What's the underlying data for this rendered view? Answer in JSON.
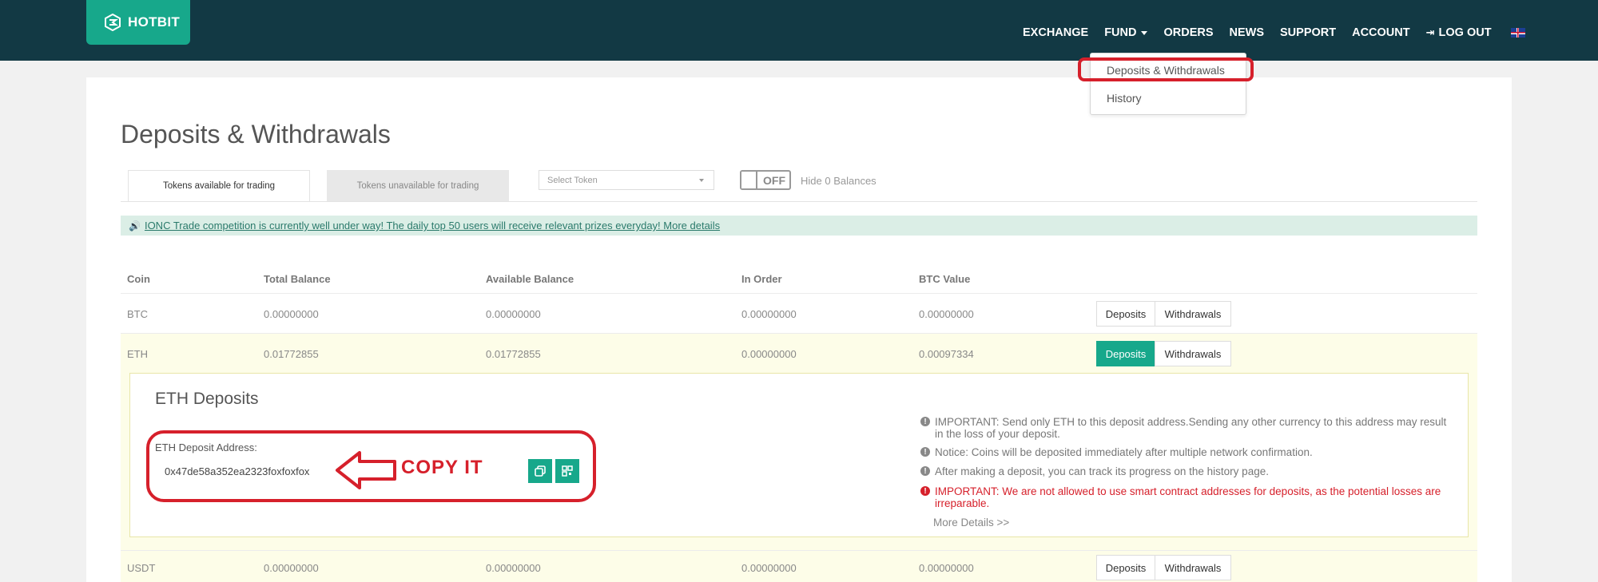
{
  "brand": {
    "name": "HOTBIT"
  },
  "nav": {
    "exchange": "EXCHANGE",
    "fund": "FUND",
    "orders": "ORDERS",
    "news": "NEWS",
    "support": "SUPPORT",
    "account": "ACCOUNT",
    "logout": "LOG OUT"
  },
  "dropdown": {
    "item1": "Deposits & Withdrawals",
    "item2": "History"
  },
  "page": {
    "title": "Deposits & Withdrawals"
  },
  "tabs": {
    "available": "Tokens available for trading",
    "unavailable": "Tokens unavailable for trading"
  },
  "filters": {
    "select_token": "Select Token",
    "toggle": "OFF",
    "hide_zero": "Hide 0 Balances"
  },
  "notice": {
    "text": "IONC Trade competition is currently well under way! The daily top 50 users will receive relevant prizes everyday! More details"
  },
  "table": {
    "headers": {
      "coin": "Coin",
      "total": "Total Balance",
      "available": "Available Balance",
      "in_order": "In Order",
      "btc_value": "BTC Value"
    },
    "rows": [
      {
        "coin": "BTC",
        "total": "0.00000000",
        "available": "0.00000000",
        "in_order": "0.00000000",
        "btc_value": "0.00000000"
      },
      {
        "coin": "ETH",
        "total": "0.01772855",
        "available": "0.01772855",
        "in_order": "0.00000000",
        "btc_value": "0.00097334"
      },
      {
        "coin": "USDT",
        "total": "0.00000000",
        "available": "0.00000000",
        "in_order": "0.00000000",
        "btc_value": "0.00000000"
      }
    ],
    "deposits_label": "Deposits",
    "withdrawals_label": "Withdrawals"
  },
  "deposit": {
    "title": "ETH Deposits",
    "address_label": "ETH Deposit Address:",
    "address": "0x47de58a352ea2323foxfoxfox",
    "annotation": "COPY IT",
    "info": [
      "IMPORTANT: Send only ETH to this deposit address.Sending any other currency to this address may result in the loss of your deposit.",
      "Notice: Coins will be deposited immediately after multiple network confirmation.",
      "After making a deposit, you can track its progress on the history page.",
      "IMPORTANT: We are not allowed to use smart contract addresses for deposits, as the potential losses are irreparable."
    ],
    "more_details": "More Details >>"
  },
  "colors": {
    "topbar": "#123944",
    "accent": "#17a88b",
    "alert_red": "#d6202b",
    "notice_bg": "#dbeee6",
    "row_highlight": "#fdfde8"
  },
  "icons": {
    "logo": "hotbit-logo-icon",
    "copy": "copy-icon",
    "qr": "qr-code-icon",
    "info": "info-icon",
    "speaker": "speaker-icon",
    "flag": "uk-flag-icon",
    "logout": "logout-icon"
  }
}
